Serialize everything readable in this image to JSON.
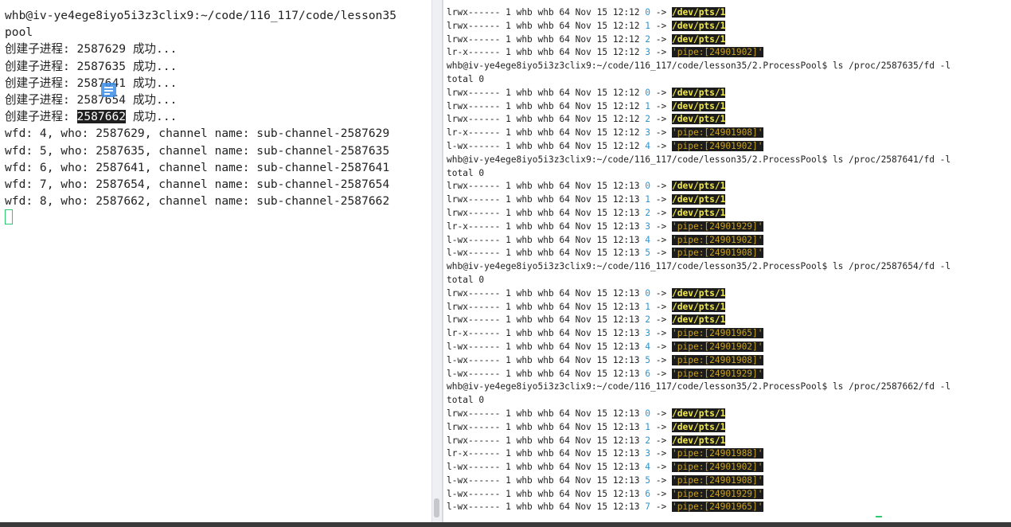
{
  "left_terminal": {
    "lines": [
      "whb@iv-ye4ege8iyo5i3z3clix9:~/code/116_117/code/lesson35",
      "pool",
      "创建子进程: 2587629 成功...",
      "创建子进程: 2587635 成功...",
      "创建子进程: 2587641 成功...",
      "创建子进程: 2587654 成功...",
      "创建子进程: 2587662 成功...",
      "wfd: 4, who: 2587629, channel name: sub-channel-2587629",
      "wfd: 5, who: 2587635, channel name: sub-channel-2587635",
      "wfd: 6, who: 2587641, channel name: sub-channel-2587641",
      "wfd: 7, who: 2587654, channel name: sub-channel-2587654",
      "wfd: 8, who: 2587662, channel name: sub-channel-2587662"
    ],
    "highlighted_pid": "2587662"
  },
  "right_terminal": {
    "lines": [
      {
        "type": "fd",
        "perm": "lrwx------",
        "fd": "0",
        "target": "/dev/pts/1",
        "time": "12:12"
      },
      {
        "type": "fd",
        "perm": "lrwx------",
        "fd": "1",
        "target": "/dev/pts/1",
        "time": "12:12"
      },
      {
        "type": "fd",
        "perm": "lrwx------",
        "fd": "2",
        "target": "/dev/pts/1",
        "time": "12:12"
      },
      {
        "type": "fd",
        "perm": "lr-x------",
        "fd": "3",
        "target": "'pipe:[24901902]'",
        "time": "12:12"
      },
      {
        "type": "prompt",
        "text": "whb@iv-ye4ege8iyo5i3z3clix9:~/code/116_117/code/lesson35/2.ProcessPool$ ls /proc/2587635/fd -l"
      },
      {
        "type": "text",
        "text": "total 0"
      },
      {
        "type": "fd",
        "perm": "lrwx------",
        "fd": "0",
        "target": "/dev/pts/1",
        "time": "12:12"
      },
      {
        "type": "fd",
        "perm": "lrwx------",
        "fd": "1",
        "target": "/dev/pts/1",
        "time": "12:12"
      },
      {
        "type": "fd",
        "perm": "lrwx------",
        "fd": "2",
        "target": "/dev/pts/1",
        "time": "12:12"
      },
      {
        "type": "fd",
        "perm": "lr-x------",
        "fd": "3",
        "target": "'pipe:[24901908]'",
        "time": "12:12"
      },
      {
        "type": "fd",
        "perm": "l-wx------",
        "fd": "4",
        "target": "'pipe:[24901902]'",
        "time": "12:12"
      },
      {
        "type": "prompt",
        "text": "whb@iv-ye4ege8iyo5i3z3clix9:~/code/116_117/code/lesson35/2.ProcessPool$ ls /proc/2587641/fd -l"
      },
      {
        "type": "text",
        "text": "total 0"
      },
      {
        "type": "fd",
        "perm": "lrwx------",
        "fd": "0",
        "target": "/dev/pts/1",
        "time": "12:13"
      },
      {
        "type": "fd",
        "perm": "lrwx------",
        "fd": "1",
        "target": "/dev/pts/1",
        "time": "12:13"
      },
      {
        "type": "fd",
        "perm": "lrwx------",
        "fd": "2",
        "target": "/dev/pts/1",
        "time": "12:13"
      },
      {
        "type": "fd",
        "perm": "lr-x------",
        "fd": "3",
        "target": "'pipe:[24901929]'",
        "time": "12:13"
      },
      {
        "type": "fd",
        "perm": "l-wx------",
        "fd": "4",
        "target": "'pipe:[24901902]'",
        "time": "12:13"
      },
      {
        "type": "fd",
        "perm": "l-wx------",
        "fd": "5",
        "target": "'pipe:[24901908]'",
        "time": "12:13"
      },
      {
        "type": "prompt",
        "text": "whb@iv-ye4ege8iyo5i3z3clix9:~/code/116_117/code/lesson35/2.ProcessPool$ ls /proc/2587654/fd -l"
      },
      {
        "type": "text",
        "text": "total 0"
      },
      {
        "type": "fd",
        "perm": "lrwx------",
        "fd": "0",
        "target": "/dev/pts/1",
        "time": "12:13"
      },
      {
        "type": "fd",
        "perm": "lrwx------",
        "fd": "1",
        "target": "/dev/pts/1",
        "time": "12:13"
      },
      {
        "type": "fd",
        "perm": "lrwx------",
        "fd": "2",
        "target": "/dev/pts/1",
        "time": "12:13"
      },
      {
        "type": "fd",
        "perm": "lr-x------",
        "fd": "3",
        "target": "'pipe:[24901965]'",
        "time": "12:13"
      },
      {
        "type": "fd",
        "perm": "l-wx------",
        "fd": "4",
        "target": "'pipe:[24901902]'",
        "time": "12:13"
      },
      {
        "type": "fd",
        "perm": "l-wx------",
        "fd": "5",
        "target": "'pipe:[24901908]'",
        "time": "12:13"
      },
      {
        "type": "fd",
        "perm": "l-wx------",
        "fd": "6",
        "target": "'pipe:[24901929]'",
        "time": "12:13"
      },
      {
        "type": "prompt",
        "text": "whb@iv-ye4ege8iyo5i3z3clix9:~/code/116_117/code/lesson35/2.ProcessPool$ ls /proc/2587662/fd -l"
      },
      {
        "type": "text",
        "text": "total 0"
      },
      {
        "type": "fd",
        "perm": "lrwx------",
        "fd": "0",
        "target": "/dev/pts/1",
        "time": "12:13"
      },
      {
        "type": "fd",
        "perm": "lrwx------",
        "fd": "1",
        "target": "/dev/pts/1",
        "time": "12:13"
      },
      {
        "type": "fd",
        "perm": "lrwx------",
        "fd": "2",
        "target": "/dev/pts/1",
        "time": "12:13"
      },
      {
        "type": "fd",
        "perm": "lr-x------",
        "fd": "3",
        "target": "'pipe:[24901988]'",
        "time": "12:13"
      },
      {
        "type": "fd",
        "perm": "l-wx------",
        "fd": "4",
        "target": "'pipe:[24901902]'",
        "time": "12:13"
      },
      {
        "type": "fd",
        "perm": "l-wx------",
        "fd": "5",
        "target": "'pipe:[24901908]'",
        "time": "12:13"
      },
      {
        "type": "fd",
        "perm": "l-wx------",
        "fd": "6",
        "target": "'pipe:[24901929]'",
        "time": "12:13"
      },
      {
        "type": "fd",
        "perm": "l-wx------",
        "fd": "7",
        "target": "'pipe:[24901965]'",
        "time": "12:13"
      }
    ],
    "fd_row_owner": "1 whb whb 64 Nov 15",
    "arrow": "->"
  },
  "colors": {
    "fd_number": "#2b96d3",
    "dev_target_fg": "#f0e84a",
    "pipe_target_fg": "#c8a020",
    "target_bg": "#1c1c1c",
    "active_tab": "#4a90d9"
  }
}
